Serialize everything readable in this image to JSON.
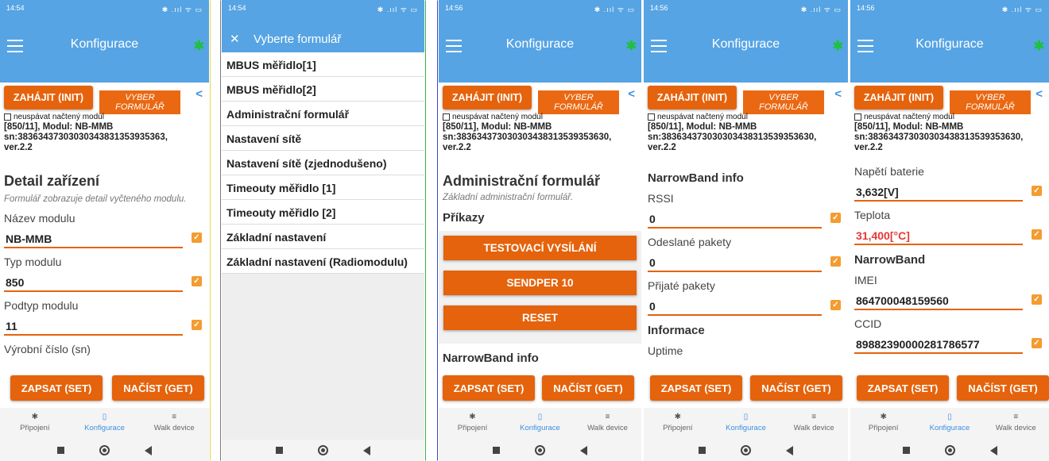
{
  "status": {
    "time1": "14:54",
    "time2": "14:54",
    "time3": "14:56",
    "time4": "14:56",
    "time5": "14:56",
    "icons": "✱ .ııl ᯤ ▭"
  },
  "appbar": {
    "title": "Konfigurace",
    "menu_icon": "hamburger-icon",
    "bt_icon": "bluetooth-icon"
  },
  "buttons": {
    "init": "ZAHÁJIT (INIT)",
    "vyber": "VYBER FORMULÁŘ",
    "set": "ZAPSAT (SET)",
    "get": "NAČÍST (GET)"
  },
  "nosleep": "neuspávat načtený modul",
  "module": {
    "line1": "[850/11], Modul: NB-MMB",
    "line2": "sn:38363437303030343831353935363,",
    "line3": "ver.2.2",
    "line2b": "sn:383634373030303438313539353630,"
  },
  "screen1": {
    "heading": "Detail zařízení",
    "desc": "Formulář zobrazuje detail vyčteného modulu.",
    "fields": [
      {
        "label": "Název modulu",
        "value": "NB-MMB"
      },
      {
        "label": "Typ modulu",
        "value": "850"
      },
      {
        "label": "Podtyp modulu",
        "value": "11"
      }
    ],
    "cut_label": "Výrobní číslo (sn)"
  },
  "screen2": {
    "title": "Vyberte formulář",
    "items": [
      "MBUS měřidlo[1]",
      "MBUS měřidlo[2]",
      "Administrační formulář",
      "Nastavení sítě",
      "Nastavení sítě (zjednodušeno)",
      "Timeouty měřidlo [1]",
      "Timeouty měřidlo [2]",
      "Základní nastavení",
      "Základní nastavení (Radiomodulu)"
    ]
  },
  "screen3": {
    "heading": "Administrační formulář",
    "desc": "Základní administrační formulář.",
    "section": "Příkazy",
    "commands": [
      "TESTOVACÍ VYSÍLÁNÍ",
      "SENDPER 10",
      "RESET"
    ],
    "section2": "NarrowBand info"
  },
  "screen4": {
    "section": "NarrowBand info",
    "fields": [
      {
        "label": "RSSI",
        "value": "0"
      },
      {
        "label": "Odeslané pakety",
        "value": "0"
      },
      {
        "label": "Přijaté pakety",
        "value": "0"
      }
    ],
    "section2": "Informace",
    "cut_label": "Uptime"
  },
  "screen5": {
    "fields1": [
      {
        "label": "Napětí baterie",
        "value": "3,632[V]"
      },
      {
        "label": "Teplota",
        "value": "31,400[°C]"
      }
    ],
    "section": "NarrowBand",
    "fields2": [
      {
        "label": "IMEI",
        "value": "864700048159560"
      },
      {
        "label": "CCID",
        "value": "89882390000281786577"
      }
    ]
  },
  "tabs": [
    {
      "label": "Připojení",
      "icon": "bluetooth-icon"
    },
    {
      "label": "Konfigurace",
      "icon": "device-icon"
    },
    {
      "label": "Walk device",
      "icon": "list-icon"
    }
  ],
  "colors": {
    "accent": "#e5630c",
    "appbar": "#56a4e4",
    "check": "#f39c30",
    "link": "#3d8fe0",
    "warn": "#e53935"
  }
}
